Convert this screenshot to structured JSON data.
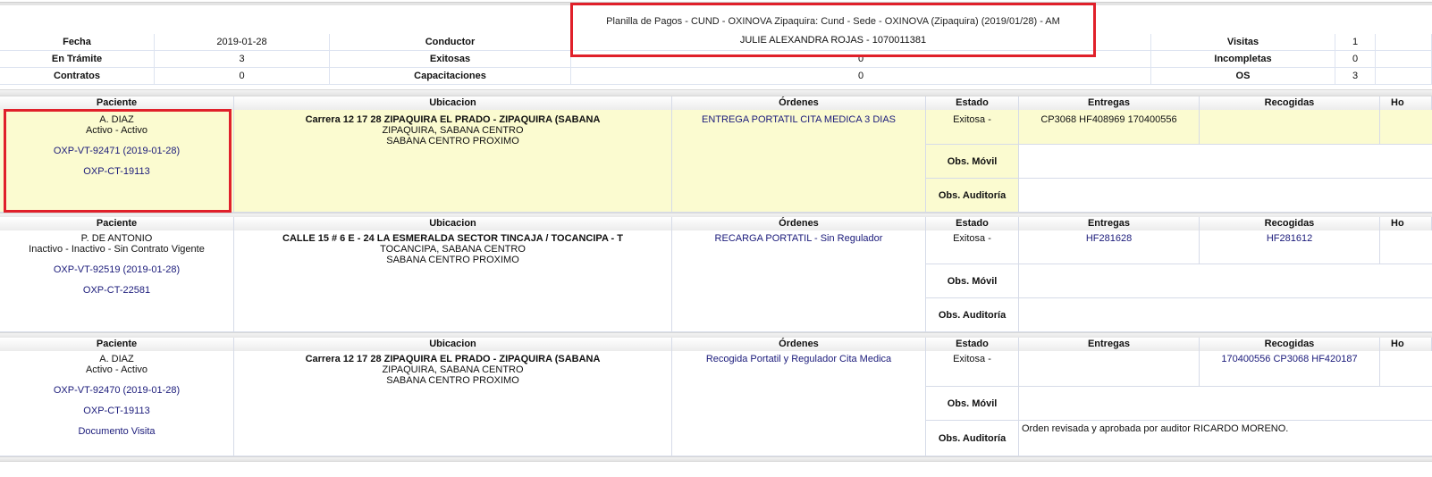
{
  "header": {
    "title": "Planilla de Pagos - CUND - OXINOVA Zipaquira: Cund - Sede - OXINOVA (Zipaquira) (2019/01/28) - AM",
    "row1": {
      "fecha_label": "Fecha",
      "fecha_value": "2019-01-28",
      "conductor_label": "Conductor",
      "conductor_value": "JULIE ALEXANDRA ROJAS - 1070011381",
      "visitas_label": "Visitas",
      "visitas_value": "1"
    },
    "row2": {
      "tramite_label": "En Trámite",
      "tramite_value": "3",
      "exitosas_label": "Exitosas",
      "exitosas_value": "0",
      "incompletas_label": "Incompletas",
      "incompletas_value": "0"
    },
    "row3": {
      "contratos_label": "Contratos",
      "contratos_value": "0",
      "capacitaciones_label": "Capacitaciones",
      "capacitaciones_value": "0",
      "os_label": "OS",
      "os_value": "3"
    }
  },
  "columns": {
    "paciente": "Paciente",
    "ubicacion": "Ubicacion",
    "ordenes": "Órdenes",
    "estado": "Estado",
    "entregas": "Entregas",
    "recogidas": "Recogidas",
    "hora": "Ho"
  },
  "labels": {
    "obs_movil": "Obs. Móvil",
    "obs_auditoria": "Obs. Auditoría"
  },
  "records": [
    {
      "paciente": {
        "name": "A. DIAZ",
        "status": "Activo - Activo",
        "visit": "OXP-VT-92471 (2019-01-28)",
        "contract": "OXP-CT-19113",
        "extra": ""
      },
      "ubicacion": {
        "line1": "Carrera 12 17 28 ZIPAQUIRA EL PRADO - ZIPAQUIRA (SABANA",
        "line2": "ZIPAQUIRA, SABANA CENTRO",
        "line3": "SABANA CENTRO PROXIMO"
      },
      "ordenes": "ENTREGA PORTATIL CITA MEDICA 3 DIAS",
      "estado": "Exitosa -",
      "entregas": "CP3068 HF408969 170400556",
      "recogidas": "",
      "obs_movil": "",
      "obs_auditoria": ""
    },
    {
      "paciente": {
        "name": "P. DE ANTONIO",
        "status": "Inactivo - Inactivo - Sin Contrato Vigente",
        "visit": "OXP-VT-92519 (2019-01-28)",
        "contract": "OXP-CT-22581",
        "extra": ""
      },
      "ubicacion": {
        "line1": "CALLE 15 # 6 E - 24 LA ESMERALDA SECTOR TINCAJA / TOCANCIPA - T",
        "line2": "TOCANCIPA, SABANA CENTRO",
        "line3": "SABANA CENTRO PROXIMO"
      },
      "ordenes": "RECARGA PORTATIL - Sin Regulador",
      "estado": "Exitosa -",
      "entregas": "HF281628",
      "recogidas": "HF281612",
      "obs_movil": "",
      "obs_auditoria": ""
    },
    {
      "paciente": {
        "name": "A. DIAZ",
        "status": "Activo - Activo",
        "visit": "OXP-VT-92470 (2019-01-28)",
        "contract": "OXP-CT-19113",
        "extra": "Documento Visita"
      },
      "ubicacion": {
        "line1": "Carrera 12 17 28 ZIPAQUIRA EL PRADO - ZIPAQUIRA (SABANA",
        "line2": "ZIPAQUIRA, SABANA CENTRO",
        "line3": "SABANA CENTRO PROXIMO"
      },
      "ordenes": "Recogida Portatil y Regulador Cita Medica",
      "estado": "Exitosa -",
      "entregas": "",
      "recogidas": "170400556 CP3068 HF420187",
      "obs_movil": "",
      "obs_auditoria": "Orden revisada y aprobada por auditor RICARDO MORENO."
    }
  ],
  "colors": {
    "highlight": "#e0202a",
    "yellow_row": "#fbfbd0",
    "link": "#1a1a7a"
  }
}
